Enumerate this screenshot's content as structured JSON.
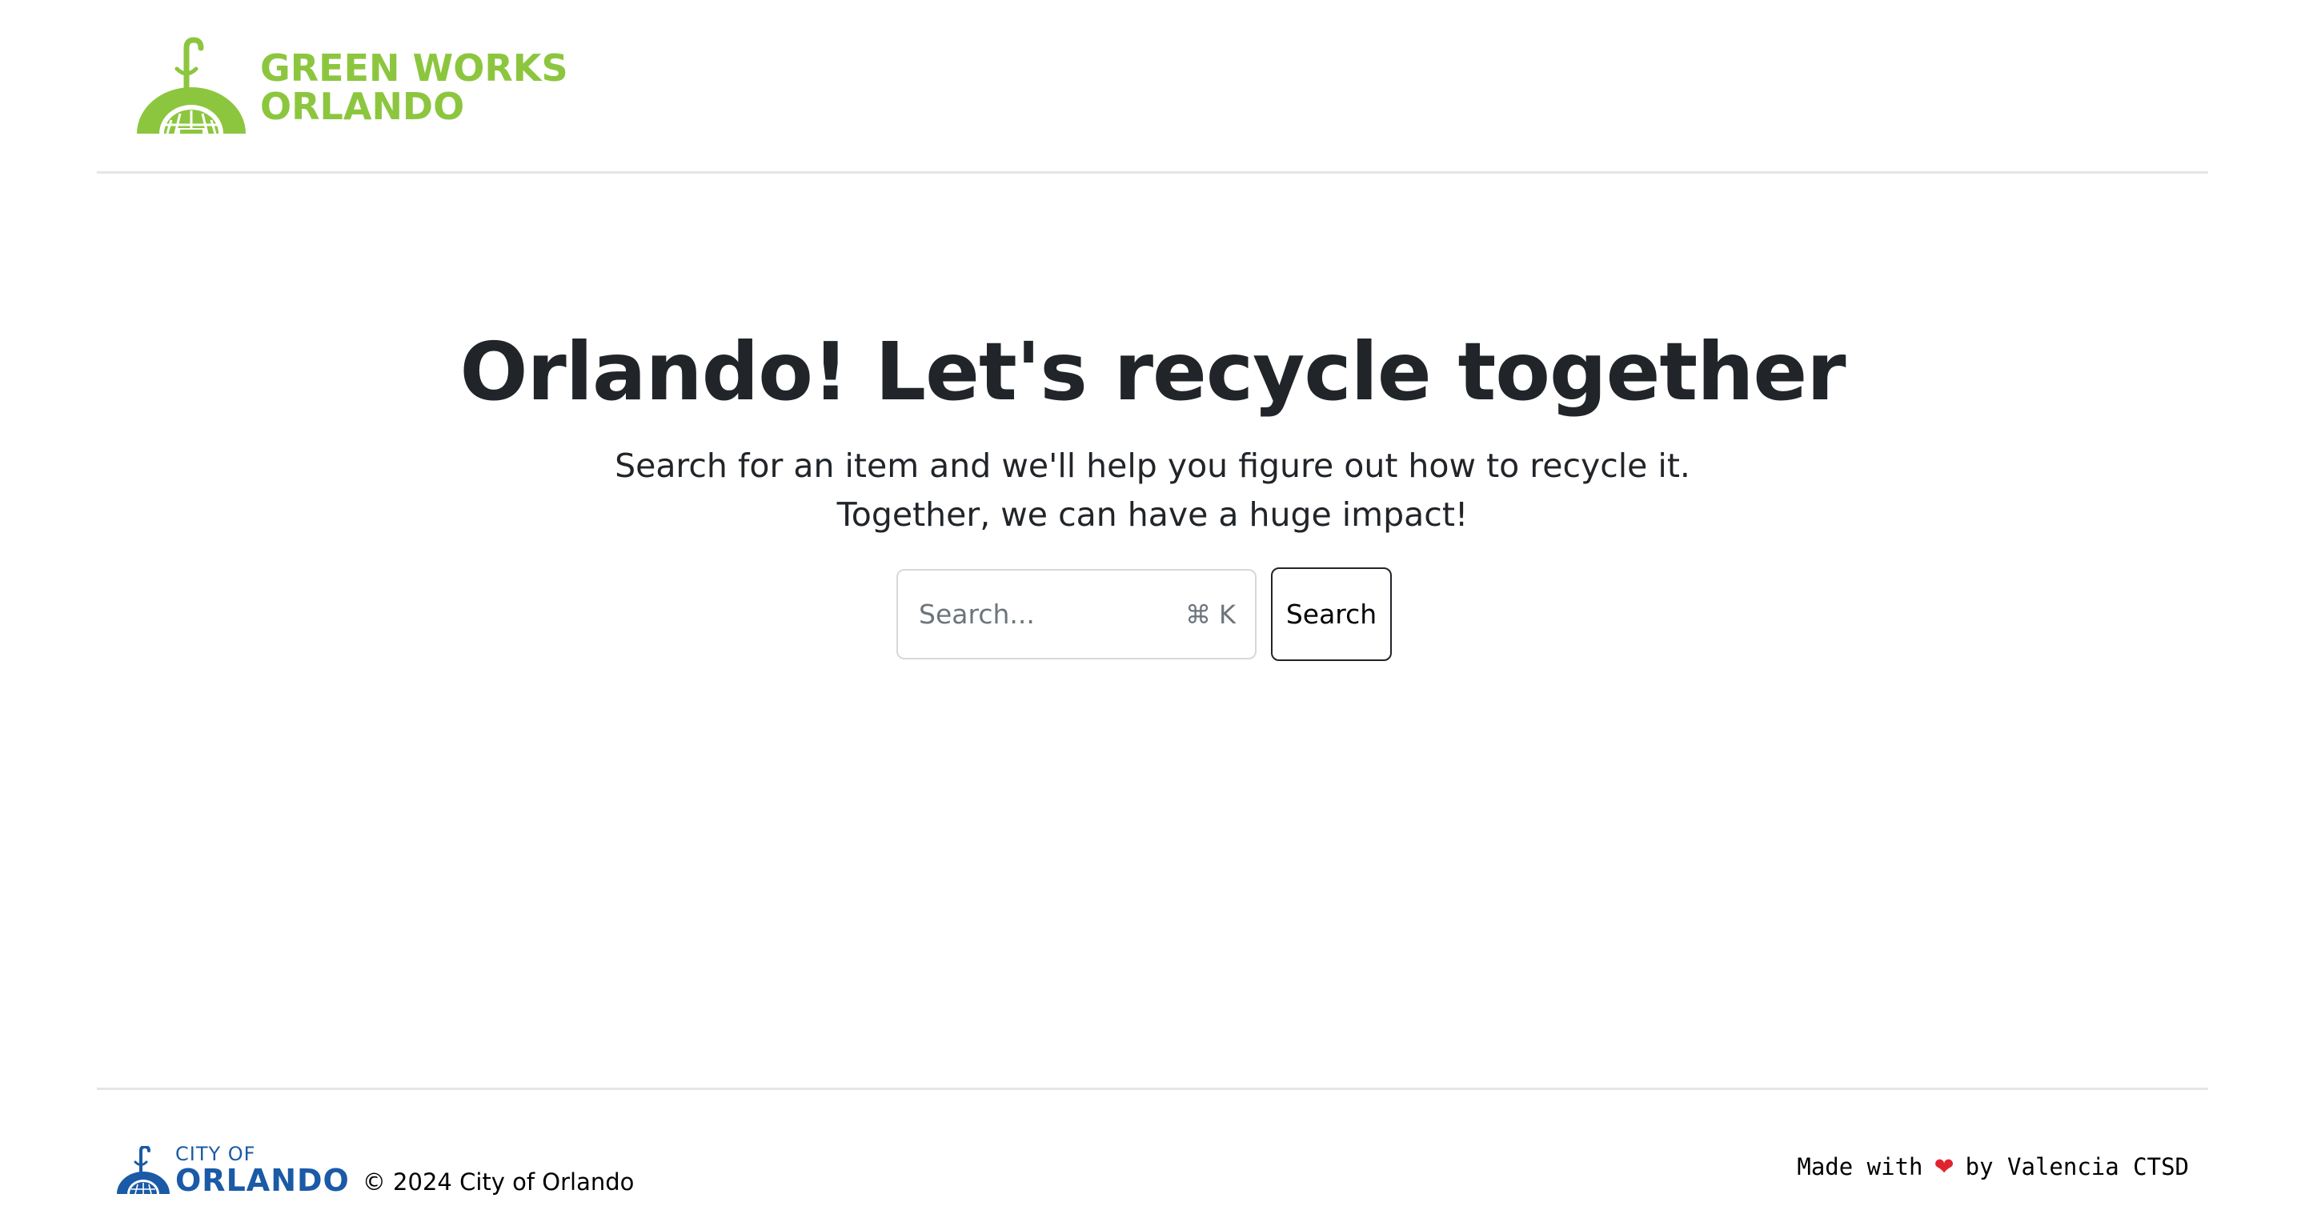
{
  "header": {
    "logo": {
      "line1": "GREEN WORKS",
      "line2": "ORLANDO",
      "color": "#8cc63f"
    }
  },
  "hero": {
    "title": "Orlando! Let's recycle together",
    "subtitle": "Search for an item and we'll help you figure out how to recycle it. Together, we can have a huge impact!"
  },
  "search": {
    "placeholder": "Search...",
    "value": "",
    "shortcut_symbol": "⌘",
    "shortcut_key": "K",
    "button_label": "Search"
  },
  "footer": {
    "city_logo": {
      "line1": "CITY OF",
      "line2": "ORLANDO",
      "color": "#1a5aa6"
    },
    "copyright": "© 2024 City of Orlando",
    "credit_prefix": "Made with",
    "credit_heart": "❤",
    "credit_suffix": "by Valencia CTSD"
  },
  "colors": {
    "brand_green": "#8cc63f",
    "city_blue": "#1a5aa6",
    "text_dark": "#212529",
    "muted": "#6c757d",
    "heart_red": "#e0242f"
  },
  "icons": {
    "brand_mark": "green-works-dome-sprout-icon",
    "city_mark": "city-of-orlando-dome-icon",
    "heart": "heart-icon",
    "command_key": "command-key-icon"
  }
}
